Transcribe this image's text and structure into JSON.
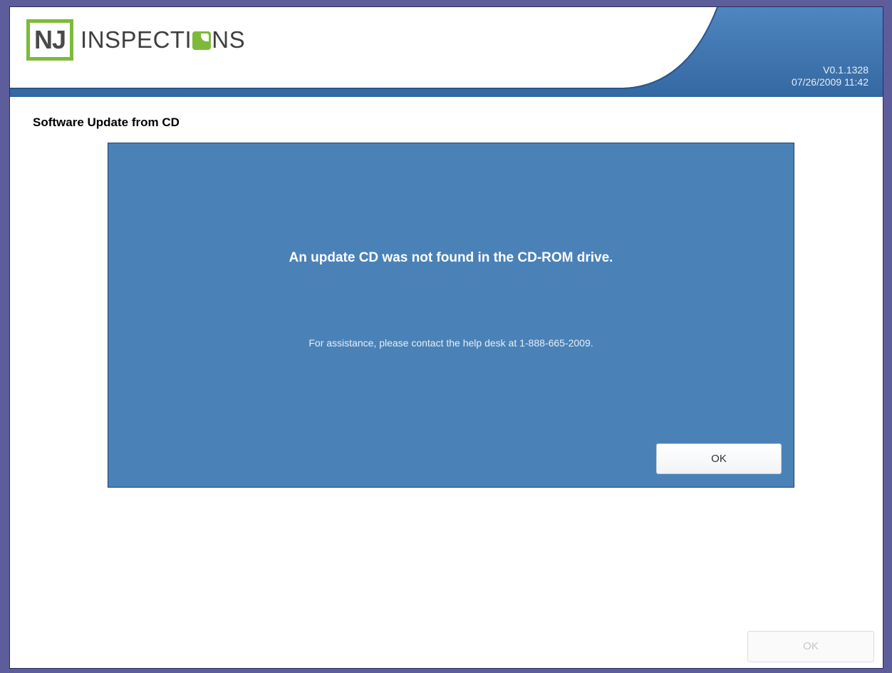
{
  "header": {
    "logo_prefix": "NJ",
    "logo_text_before_o": "INSPECTI",
    "logo_text_after_o": "NS",
    "version": "V0.1.1328",
    "datetime": "07/26/2009 11:42",
    "accent_color": "#7dba3c",
    "bar_color": "#3a72ad"
  },
  "page": {
    "title": "Software Update from CD"
  },
  "dialog": {
    "message": "An update CD was not found in the CD-ROM drive.",
    "help_text": "For assistance, please contact the help desk at 1-888-665-2009.",
    "ok_label": "OK",
    "background_color": "#4a82b8"
  },
  "footer": {
    "ok_label": "OK",
    "ok_state": "disabled"
  }
}
